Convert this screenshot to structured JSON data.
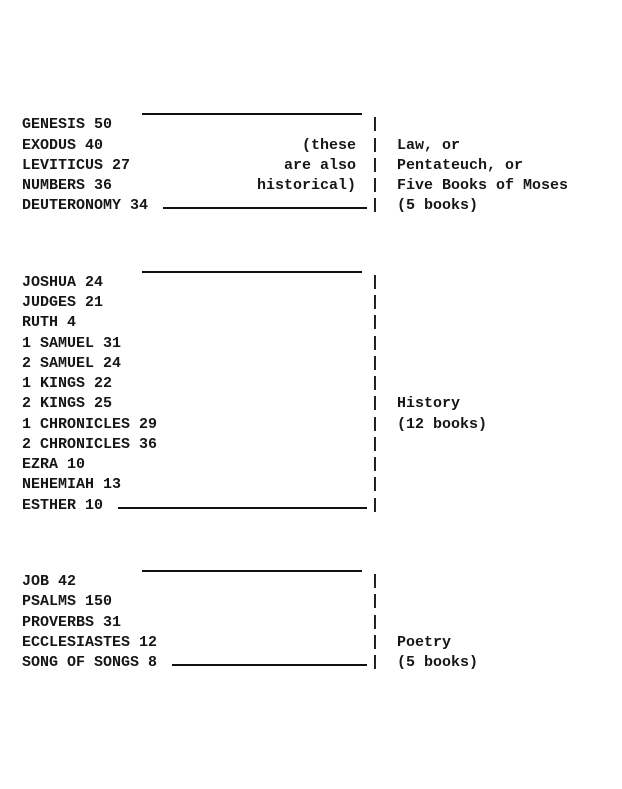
{
  "pipe": "|",
  "sections": [
    {
      "note_lines": [
        "(these",
        "are also",
        "historical)"
      ],
      "books": [
        {
          "name": "GENESIS",
          "chapters": "50"
        },
        {
          "name": "EXODUS",
          "chapters": "40"
        },
        {
          "name": "LEVITICUS",
          "chapters": "27"
        },
        {
          "name": "NUMBERS",
          "chapters": "36"
        },
        {
          "name": "DEUTERONOMY",
          "chapters": "34"
        }
      ],
      "desc_lines": [
        "",
        "Law, or",
        "Pentateuch, or",
        "Five Books of Moses",
        "(5 books)"
      ]
    },
    {
      "note_lines": [],
      "books": [
        {
          "name": "JOSHUA",
          "chapters": "24"
        },
        {
          "name": "JUDGES",
          "chapters": "21"
        },
        {
          "name": "RUTH",
          "chapters": "4"
        },
        {
          "name": "1 SAMUEL",
          "chapters": "31"
        },
        {
          "name": "2 SAMUEL",
          "chapters": "24"
        },
        {
          "name": "1 KINGS",
          "chapters": "22"
        },
        {
          "name": "2 KINGS",
          "chapters": "25"
        },
        {
          "name": "1 CHRONICLES",
          "chapters": "29"
        },
        {
          "name": "2 CHRONICLES",
          "chapters": "36"
        },
        {
          "name": "EZRA",
          "chapters": "10"
        },
        {
          "name": "NEHEMIAH",
          "chapters": "13"
        },
        {
          "name": "ESTHER",
          "chapters": "10"
        }
      ],
      "desc_lines": [
        "",
        "",
        "",
        "",
        "",
        "",
        "History",
        "(12 books)",
        "",
        "",
        "",
        "",
        ""
      ]
    },
    {
      "note_lines": [],
      "books": [
        {
          "name": "JOB",
          "chapters": "42"
        },
        {
          "name": "PSALMS",
          "chapters": "150"
        },
        {
          "name": "PROVERBS",
          "chapters": "31"
        },
        {
          "name": "ECCLESIASTES",
          "chapters": "12"
        },
        {
          "name": "SONG OF SONGS",
          "chapters": "8"
        }
      ],
      "desc_lines": [
        "",
        "",
        "",
        "Poetry",
        "(5 books)",
        ""
      ]
    }
  ]
}
